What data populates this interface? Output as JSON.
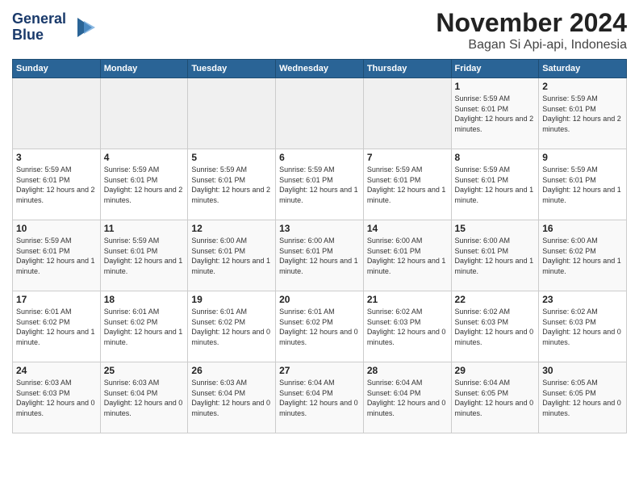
{
  "header": {
    "logo_line1": "General",
    "logo_line2": "Blue",
    "month_title": "November 2024",
    "location": "Bagan Si Api-api, Indonesia"
  },
  "weekdays": [
    "Sunday",
    "Monday",
    "Tuesday",
    "Wednesday",
    "Thursday",
    "Friday",
    "Saturday"
  ],
  "weeks": [
    [
      {
        "day": "",
        "sunrise": "",
        "sunset": "",
        "daylight": ""
      },
      {
        "day": "",
        "sunrise": "",
        "sunset": "",
        "daylight": ""
      },
      {
        "day": "",
        "sunrise": "",
        "sunset": "",
        "daylight": ""
      },
      {
        "day": "",
        "sunrise": "",
        "sunset": "",
        "daylight": ""
      },
      {
        "day": "",
        "sunrise": "",
        "sunset": "",
        "daylight": ""
      },
      {
        "day": "1",
        "sunrise": "Sunrise: 5:59 AM",
        "sunset": "Sunset: 6:01 PM",
        "daylight": "Daylight: 12 hours and 2 minutes."
      },
      {
        "day": "2",
        "sunrise": "Sunrise: 5:59 AM",
        "sunset": "Sunset: 6:01 PM",
        "daylight": "Daylight: 12 hours and 2 minutes."
      }
    ],
    [
      {
        "day": "3",
        "sunrise": "Sunrise: 5:59 AM",
        "sunset": "Sunset: 6:01 PM",
        "daylight": "Daylight: 12 hours and 2 minutes."
      },
      {
        "day": "4",
        "sunrise": "Sunrise: 5:59 AM",
        "sunset": "Sunset: 6:01 PM",
        "daylight": "Daylight: 12 hours and 2 minutes."
      },
      {
        "day": "5",
        "sunrise": "Sunrise: 5:59 AM",
        "sunset": "Sunset: 6:01 PM",
        "daylight": "Daylight: 12 hours and 2 minutes."
      },
      {
        "day": "6",
        "sunrise": "Sunrise: 5:59 AM",
        "sunset": "Sunset: 6:01 PM",
        "daylight": "Daylight: 12 hours and 1 minute."
      },
      {
        "day": "7",
        "sunrise": "Sunrise: 5:59 AM",
        "sunset": "Sunset: 6:01 PM",
        "daylight": "Daylight: 12 hours and 1 minute."
      },
      {
        "day": "8",
        "sunrise": "Sunrise: 5:59 AM",
        "sunset": "Sunset: 6:01 PM",
        "daylight": "Daylight: 12 hours and 1 minute."
      },
      {
        "day": "9",
        "sunrise": "Sunrise: 5:59 AM",
        "sunset": "Sunset: 6:01 PM",
        "daylight": "Daylight: 12 hours and 1 minute."
      }
    ],
    [
      {
        "day": "10",
        "sunrise": "Sunrise: 5:59 AM",
        "sunset": "Sunset: 6:01 PM",
        "daylight": "Daylight: 12 hours and 1 minute."
      },
      {
        "day": "11",
        "sunrise": "Sunrise: 5:59 AM",
        "sunset": "Sunset: 6:01 PM",
        "daylight": "Daylight: 12 hours and 1 minute."
      },
      {
        "day": "12",
        "sunrise": "Sunrise: 6:00 AM",
        "sunset": "Sunset: 6:01 PM",
        "daylight": "Daylight: 12 hours and 1 minute."
      },
      {
        "day": "13",
        "sunrise": "Sunrise: 6:00 AM",
        "sunset": "Sunset: 6:01 PM",
        "daylight": "Daylight: 12 hours and 1 minute."
      },
      {
        "day": "14",
        "sunrise": "Sunrise: 6:00 AM",
        "sunset": "Sunset: 6:01 PM",
        "daylight": "Daylight: 12 hours and 1 minute."
      },
      {
        "day": "15",
        "sunrise": "Sunrise: 6:00 AM",
        "sunset": "Sunset: 6:01 PM",
        "daylight": "Daylight: 12 hours and 1 minute."
      },
      {
        "day": "16",
        "sunrise": "Sunrise: 6:00 AM",
        "sunset": "Sunset: 6:02 PM",
        "daylight": "Daylight: 12 hours and 1 minute."
      }
    ],
    [
      {
        "day": "17",
        "sunrise": "Sunrise: 6:01 AM",
        "sunset": "Sunset: 6:02 PM",
        "daylight": "Daylight: 12 hours and 1 minute."
      },
      {
        "day": "18",
        "sunrise": "Sunrise: 6:01 AM",
        "sunset": "Sunset: 6:02 PM",
        "daylight": "Daylight: 12 hours and 1 minute."
      },
      {
        "day": "19",
        "sunrise": "Sunrise: 6:01 AM",
        "sunset": "Sunset: 6:02 PM",
        "daylight": "Daylight: 12 hours and 0 minutes."
      },
      {
        "day": "20",
        "sunrise": "Sunrise: 6:01 AM",
        "sunset": "Sunset: 6:02 PM",
        "daylight": "Daylight: 12 hours and 0 minutes."
      },
      {
        "day": "21",
        "sunrise": "Sunrise: 6:02 AM",
        "sunset": "Sunset: 6:03 PM",
        "daylight": "Daylight: 12 hours and 0 minutes."
      },
      {
        "day": "22",
        "sunrise": "Sunrise: 6:02 AM",
        "sunset": "Sunset: 6:03 PM",
        "daylight": "Daylight: 12 hours and 0 minutes."
      },
      {
        "day": "23",
        "sunrise": "Sunrise: 6:02 AM",
        "sunset": "Sunset: 6:03 PM",
        "daylight": "Daylight: 12 hours and 0 minutes."
      }
    ],
    [
      {
        "day": "24",
        "sunrise": "Sunrise: 6:03 AM",
        "sunset": "Sunset: 6:03 PM",
        "daylight": "Daylight: 12 hours and 0 minutes."
      },
      {
        "day": "25",
        "sunrise": "Sunrise: 6:03 AM",
        "sunset": "Sunset: 6:04 PM",
        "daylight": "Daylight: 12 hours and 0 minutes."
      },
      {
        "day": "26",
        "sunrise": "Sunrise: 6:03 AM",
        "sunset": "Sunset: 6:04 PM",
        "daylight": "Daylight: 12 hours and 0 minutes."
      },
      {
        "day": "27",
        "sunrise": "Sunrise: 6:04 AM",
        "sunset": "Sunset: 6:04 PM",
        "daylight": "Daylight: 12 hours and 0 minutes."
      },
      {
        "day": "28",
        "sunrise": "Sunrise: 6:04 AM",
        "sunset": "Sunset: 6:04 PM",
        "daylight": "Daylight: 12 hours and 0 minutes."
      },
      {
        "day": "29",
        "sunrise": "Sunrise: 6:04 AM",
        "sunset": "Sunset: 6:05 PM",
        "daylight": "Daylight: 12 hours and 0 minutes."
      },
      {
        "day": "30",
        "sunrise": "Sunrise: 6:05 AM",
        "sunset": "Sunset: 6:05 PM",
        "daylight": "Daylight: 12 hours and 0 minutes."
      }
    ]
  ]
}
